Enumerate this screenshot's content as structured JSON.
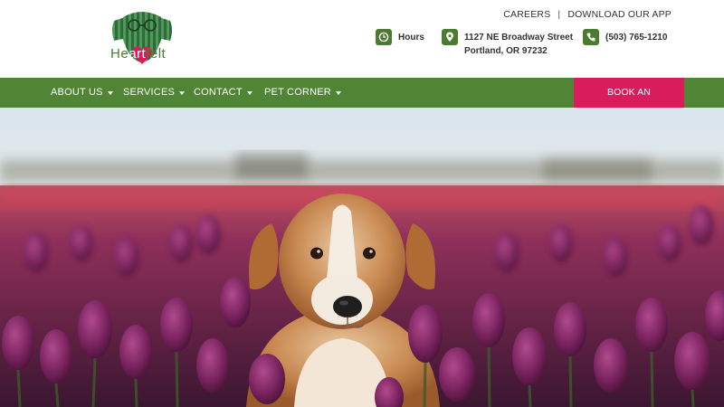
{
  "brand": {
    "logo_text_pre": "He",
    "logo_text_art": "art",
    "logo_text_post": "felt",
    "colors": {
      "green": "#4f8534",
      "pink": "#d91c5c"
    }
  },
  "top_links": {
    "careers": "CAREERS",
    "separator": "|",
    "app": "DOWNLOAD OUR APP"
  },
  "contact_info": {
    "hours_label": "Hours",
    "address_line1": "1127 NE Broadway Street",
    "address_line2": "Portland, OR 97232",
    "phone": "(503) 765-1210",
    "icons": [
      "clock-icon",
      "location-pin-icon",
      "phone-icon"
    ]
  },
  "nav": {
    "items": [
      {
        "label": "ABOUT US"
      },
      {
        "label": "SERVICES"
      },
      {
        "label": "CONTACT"
      },
      {
        "label": "PET CORNER"
      }
    ],
    "cta": "BOOK AN APPOINTMENT"
  },
  "hero": {
    "image": "dog-in-tulip-field"
  }
}
